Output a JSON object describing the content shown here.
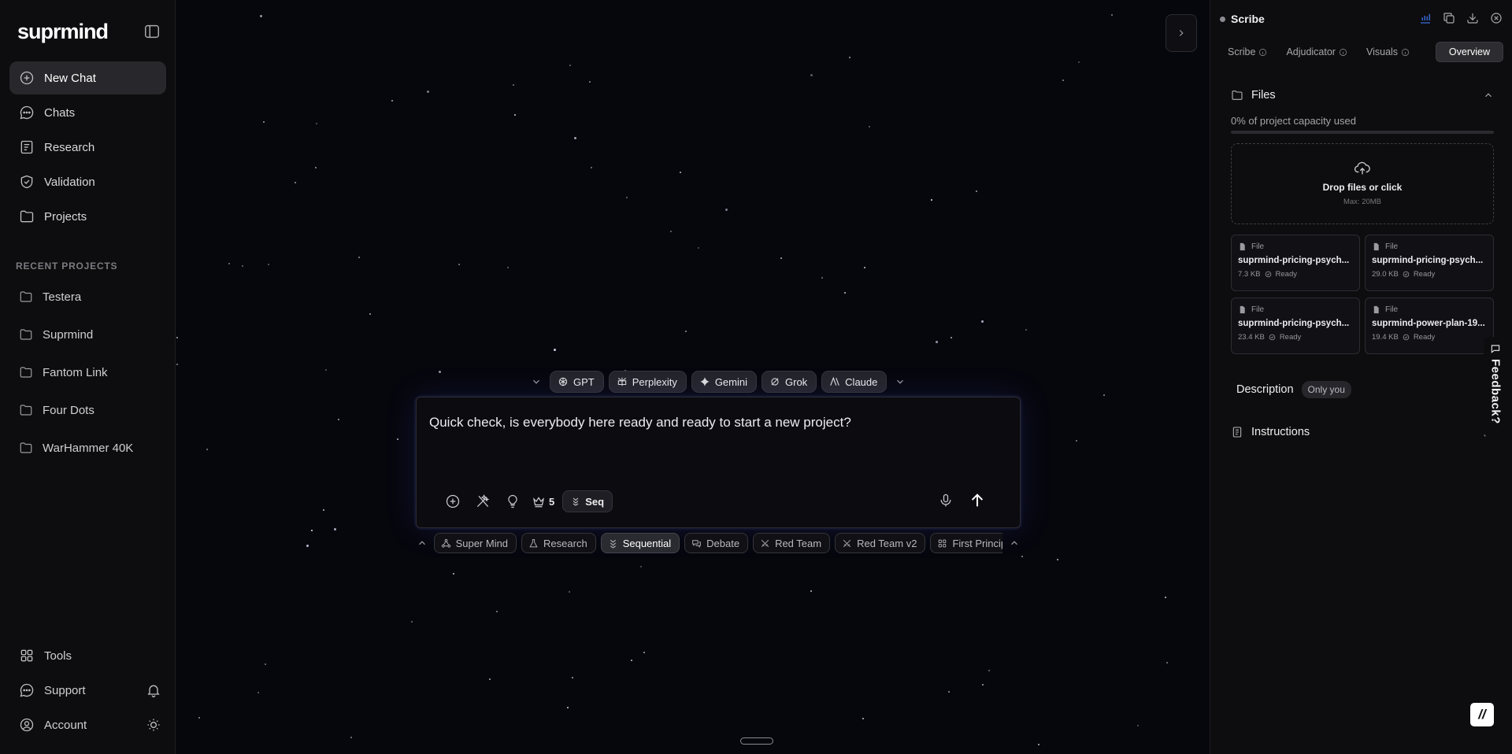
{
  "app": {
    "logo": "suprmind"
  },
  "sidebar": {
    "nav": [
      {
        "label": "New Chat",
        "icon": "plus-circle-icon"
      },
      {
        "label": "Chats",
        "icon": "chat-bubble-icon"
      },
      {
        "label": "Research",
        "icon": "research-icon"
      },
      {
        "label": "Validation",
        "icon": "shield-check-icon"
      },
      {
        "label": "Projects",
        "icon": "folder-icon"
      }
    ],
    "recent_label": "RECENT PROJECTS",
    "projects": [
      "Testera",
      "Suprmind",
      "Fantom Link",
      "Four Dots",
      "WarHammer 40K"
    ],
    "bottom": [
      {
        "label": "Tools",
        "icon": "grid-icon"
      },
      {
        "label": "Support",
        "icon": "chat-bubble-icon",
        "trail": "bell-icon"
      },
      {
        "label": "Account",
        "icon": "user-icon",
        "trail": "sun-icon"
      }
    ]
  },
  "composer": {
    "models": [
      "GPT",
      "Perplexity",
      "Gemini",
      "Grok",
      "Claude"
    ],
    "text": "Quick check, is everybody here ready and ready to start a new project?",
    "crown_count": "5",
    "seq_label": "Seq",
    "modes": [
      "Super Mind",
      "Research",
      "Sequential",
      "Debate",
      "Red Team",
      "Red Team v2",
      "First Princip"
    ],
    "active_mode": "Sequential"
  },
  "panel": {
    "title": "Scribe",
    "tabs": [
      "Scribe",
      "Adjudicator",
      "Visuals",
      "Overview"
    ],
    "active_tab": "Overview",
    "files_title": "Files",
    "capacity_text": "0% of project capacity used",
    "capacity_fraction": 0.0,
    "drop_text": "Drop files or click",
    "drop_sub": "Max: 20MB",
    "files": [
      {
        "type": "File",
        "name": "suprmind-pricing-psych...",
        "size": "7.3 KB",
        "status": "Ready"
      },
      {
        "type": "File",
        "name": "suprmind-pricing-psych...",
        "size": "29.0 KB",
        "status": "Ready"
      },
      {
        "type": "File",
        "name": "suprmind-pricing-psych...",
        "size": "23.4 KB",
        "status": "Ready"
      },
      {
        "type": "File",
        "name": "suprmind-power-plan-19...",
        "size": "19.4 KB",
        "status": "Ready"
      }
    ],
    "description_label": "Description",
    "description_badge": "Only you",
    "instructions_label": "Instructions",
    "feedback_label": "Feedback?",
    "brand_badge": "//"
  }
}
